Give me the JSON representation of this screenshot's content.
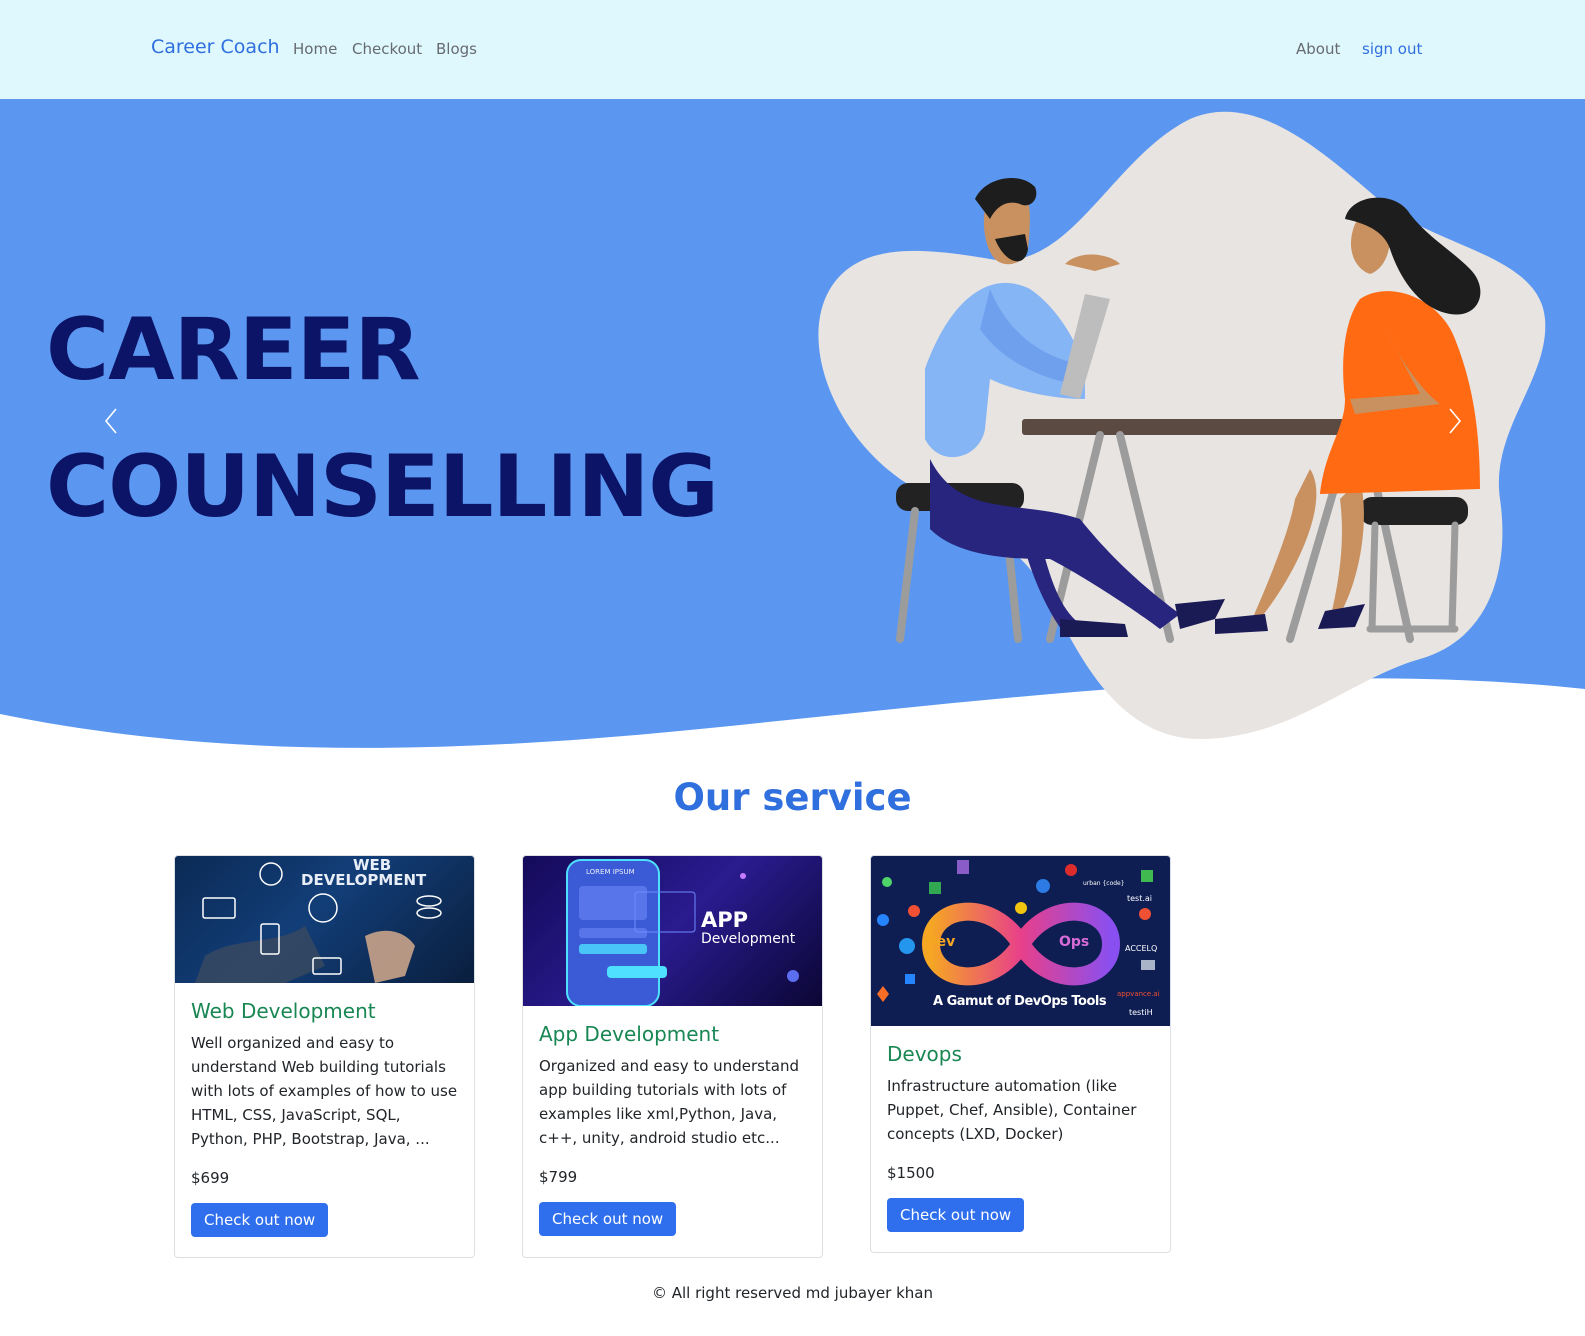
{
  "navbar": {
    "brand": "Career Coach",
    "links": [
      "Home",
      "Checkout",
      "Blogs"
    ],
    "right_links": [
      "About",
      "sign out"
    ]
  },
  "hero": {
    "line1": "CAREER",
    "line2": "COUNSELLING",
    "colors": {
      "background": "#5b97f0",
      "title": "#0b1466",
      "blob": "#e8e4e2"
    }
  },
  "services": {
    "title": "Our service",
    "cards": [
      {
        "title": "Web Development",
        "image_label_1": "WEB",
        "image_label_2": "DEVELOPMENT",
        "description": "Well organized and easy to understand Web building tutorials with lots of examples of how to use HTML, CSS, JavaScript, SQL, Python, PHP, Bootstrap, Java, ...",
        "price": "$699",
        "button": "Check out now"
      },
      {
        "title": "App Development",
        "image_label_1": "APP",
        "image_label_2": "Development",
        "image_label_3": "LOREM IPSUM",
        "description": "Organized and easy to understand app building tutorials with lots of examples like xml,Python, Java, c++, unity, android studio etc...",
        "price": "$799",
        "button": "Check out now"
      },
      {
        "title": "Devops",
        "image_label_1": "Dev",
        "image_label_2": "Ops",
        "image_label_3": "A Gamut of DevOps Tools",
        "image_label_4": "test.ai",
        "image_label_5": "ACCELQ",
        "image_label_6": "urban {code}",
        "image_label_7": "appvance.ai",
        "image_label_8": "testiH",
        "description": "Infrastructure automation (like Puppet, Chef, Ansible), Container concepts (LXD, Docker)",
        "price": "$1500",
        "button": "Check out now"
      }
    ]
  },
  "footer": {
    "text": "© All right reserved md jubayer khan"
  }
}
